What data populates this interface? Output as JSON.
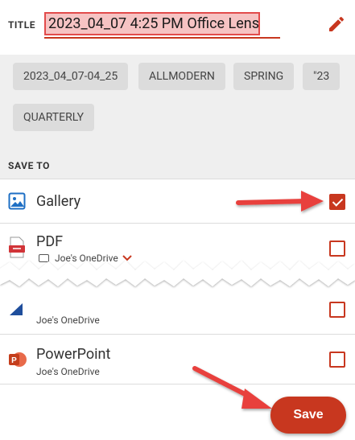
{
  "header": {
    "title_label": "TITLE",
    "title_value": "2023_04_07 4:25 PM Office Lens"
  },
  "tags": [
    "2023_04_07-04_25",
    "ALLMODERN",
    "SPRING",
    "\"23",
    "QUARTERLY"
  ],
  "save_to": {
    "label": "SAVE TO",
    "items": [
      {
        "name": "Gallery",
        "sub": "",
        "checked": true,
        "icon": "gallery-icon"
      },
      {
        "name": "PDF",
        "sub": "Joe's OneDrive",
        "checked": false,
        "icon": "pdf-icon"
      },
      {
        "name": "",
        "sub": "Joe's OneDrive",
        "checked": false,
        "icon": "word-icon"
      },
      {
        "name": "PowerPoint",
        "sub": "Joe's OneDrive",
        "checked": false,
        "icon": "powerpoint-icon"
      }
    ]
  },
  "actions": {
    "save_label": "Save"
  },
  "colors": {
    "accent": "#c8371f",
    "highlight": "#f6c3c3",
    "annotation": "#e24b4b"
  }
}
